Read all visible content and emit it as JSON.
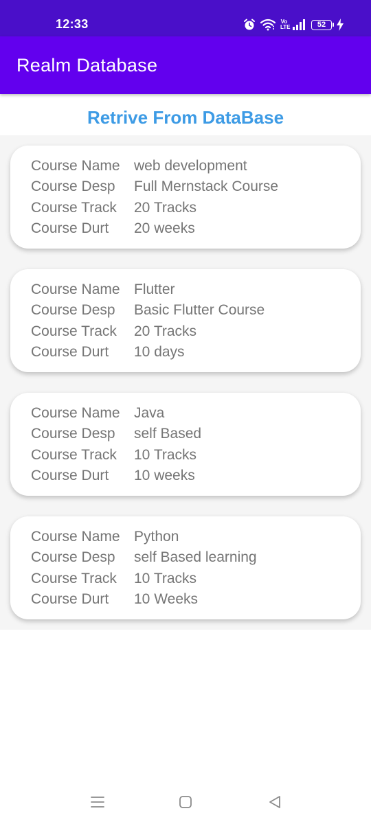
{
  "status_bar": {
    "time": "12:33",
    "volte_line1": "Vo",
    "volte_line2": "LTE",
    "battery_level": "52",
    "icons": [
      "alarm-icon",
      "wifi-icon",
      "volte-icon",
      "signal-icon",
      "battery-icon",
      "charging-icon"
    ]
  },
  "app_bar": {
    "title": "Realm Database"
  },
  "page": {
    "heading": "Retrive From DataBase"
  },
  "courses": [
    {
      "name_label": "Course Name",
      "name": "web development",
      "desp_label": "Course Desp",
      "desp": "Full Mernstack Course",
      "track_label": "Course Track",
      "track": "20 Tracks",
      "durt_label": "Course Durt",
      "durt": "20 weeks"
    },
    {
      "name_label": "Course Name",
      "name": "Flutter",
      "desp_label": "Course Desp",
      "desp": "Basic Flutter Course",
      "track_label": "Course Track",
      "track": "20 Tracks",
      "durt_label": "Course Durt",
      "durt": "10 days"
    },
    {
      "name_label": "Course Name",
      "name": "Java",
      "desp_label": "Course Desp",
      "desp": "self Based",
      "track_label": "Course Track",
      "track": "10 Tracks",
      "durt_label": "Course Durt",
      "durt": "10 weeks"
    },
    {
      "name_label": "Course Name",
      "name": "Python",
      "desp_label": "Course Desp",
      "desp": "self Based learning",
      "track_label": "Course Track",
      "track": "10 Tracks",
      "durt_label": "Course Durt",
      "durt": "10 Weeks"
    }
  ],
  "nav_bar": {
    "icons": [
      "menu-icon",
      "home-icon",
      "back-icon"
    ]
  },
  "colors": {
    "status_bar": "#4a0fc9",
    "app_bar": "#6200ee",
    "heading": "#3d9be5",
    "text": "#757575"
  }
}
